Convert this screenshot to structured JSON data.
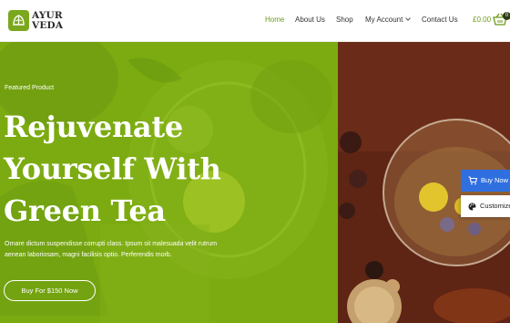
{
  "brand": {
    "line1": "AYUR",
    "line2": "VEDA"
  },
  "nav": [
    {
      "label": "Home",
      "active": true
    },
    {
      "label": "About Us",
      "active": false
    },
    {
      "label": "Shop",
      "active": false
    },
    {
      "label": "My Account",
      "active": false,
      "dropdown": true
    },
    {
      "label": "Contact Us",
      "active": false
    }
  ],
  "cart": {
    "amount": "£0.00",
    "count": "0",
    "icon": "basket-icon"
  },
  "hero": {
    "eyebrow": "Featured Product",
    "headline": "Rejuvenate Yourself With Green Tea",
    "description": "Ornare dictum suspendisse corrupti class. Ipsum sit malesuada velit rutrum aenean laboriosam, magni facilisis optio. Perferendis morb.",
    "cta_label": "Buy For $150 Now"
  },
  "floating": {
    "buy_now": "Buy Now",
    "customize": "Customize"
  },
  "colors": {
    "accent": "#6c9a1a",
    "hero_green": "#7bab10",
    "buy_now_blue": "#2f6fe0"
  }
}
